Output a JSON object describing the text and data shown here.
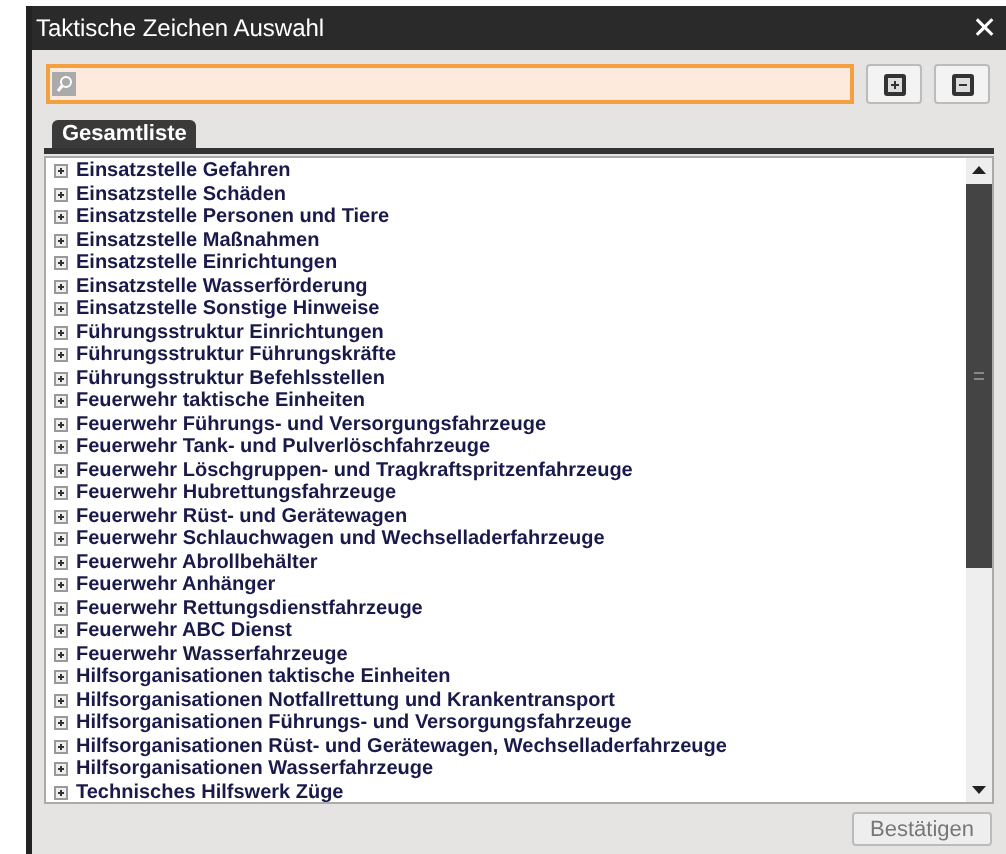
{
  "window": {
    "title": "Taktische Zeichen Auswahl",
    "close": "✕"
  },
  "tabs": [
    {
      "label": "Gesamtliste",
      "selected": true
    }
  ],
  "tree": {
    "items": [
      {
        "label": "Einsatzstelle Gefahren",
        "expanded": false
      },
      {
        "label": "Einsatzstelle Schäden",
        "expanded": false
      },
      {
        "label": "Einsatzstelle Personen und Tiere",
        "expanded": false
      },
      {
        "label": "Einsatzstelle Maßnahmen",
        "expanded": false
      },
      {
        "label": "Einsatzstelle Einrichtungen",
        "expanded": false
      },
      {
        "label": "Einsatzstelle Wasserförderung",
        "expanded": false
      },
      {
        "label": "Einsatzstelle Sonstige Hinweise",
        "expanded": false
      },
      {
        "label": "Führungsstruktur Einrichtungen",
        "expanded": false
      },
      {
        "label": "Führungsstruktur Führungskräfte",
        "expanded": false
      },
      {
        "label": "Führungsstruktur Befehlsstellen",
        "expanded": false
      },
      {
        "label": "Feuerwehr taktische Einheiten",
        "expanded": false
      },
      {
        "label": "Feuerwehr Führungs- und Versorgungsfahrzeuge",
        "expanded": false
      },
      {
        "label": "Feuerwehr Tank- und Pulverlöschfahrzeuge",
        "expanded": false
      },
      {
        "label": "Feuerwehr Löschgruppen- und Tragkraftspritzenfahrzeuge",
        "expanded": false
      },
      {
        "label": "Feuerwehr Hubrettungsfahrzeuge",
        "expanded": false
      },
      {
        "label": "Feuerwehr Rüst- und Gerätewagen",
        "expanded": false
      },
      {
        "label": "Feuerwehr Schlauchwagen und Wechselladerfahrzeuge",
        "expanded": false
      },
      {
        "label": "Feuerwehr Abrollbehälter",
        "expanded": false
      },
      {
        "label": "Feuerwehr Anhänger",
        "expanded": false
      },
      {
        "label": "Feuerwehr Rettungsdienstfahrzeuge",
        "expanded": false
      },
      {
        "label": "Feuerwehr ABC Dienst",
        "expanded": false
      },
      {
        "label": "Feuerwehr Wasserfahrzeuge",
        "expanded": false
      },
      {
        "label": "Hilfsorganisationen taktische Einheiten",
        "expanded": false
      },
      {
        "label": "Hilfsorganisationen Notfallrettung und Krankentransport",
        "expanded": false
      },
      {
        "label": "Hilfsorganisationen Führungs- und Versorgungsfahrzeuge",
        "expanded": false
      },
      {
        "label": "Hilfsorganisationen Rüst- und Gerätewagen, Wechselladerfahrzeuge",
        "expanded": false
      },
      {
        "label": "Hilfsorganisationen Wasserfahrzeuge",
        "expanded": false
      },
      {
        "label": "Technisches Hilfswerk Züge",
        "expanded": false
      }
    ]
  },
  "confirm_button": {
    "label": "Bestätigen",
    "disabled": true
  }
}
